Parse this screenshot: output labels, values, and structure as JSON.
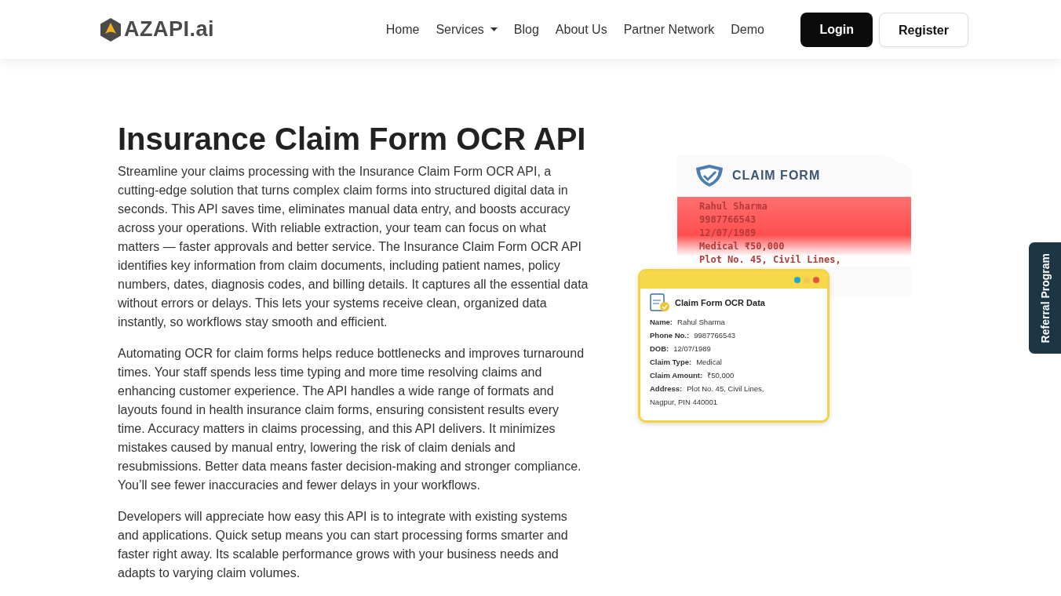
{
  "header": {
    "logo": "AZAPI.ai",
    "nav": [
      {
        "label": "Home",
        "dropdown": false
      },
      {
        "label": "Services",
        "dropdown": true
      },
      {
        "label": "Blog",
        "dropdown": false
      },
      {
        "label": "About Us",
        "dropdown": false
      },
      {
        "label": "Partner Network",
        "dropdown": false
      },
      {
        "label": "Demo",
        "dropdown": false
      }
    ],
    "buttons": [
      {
        "label": "Login",
        "kind": "primary"
      },
      {
        "label": "Register",
        "kind": "outline"
      }
    ]
  },
  "hero": {
    "title": "Insurance Claim Form OCR API",
    "paragraphs": [
      "Streamline your claims processing with the Insurance Claim Form OCR API, a cutting-edge solution that turns complex claim forms into structured digital data in seconds. This API saves time, eliminates manual data entry, and boosts accuracy across your operations. With reliable extraction, your team can focus on what matters — faster approvals and better service. The Insurance Claim Form OCR API identifies key information from claim documents, including patient names, policy numbers, dates, diagnosis codes, and billing details. It captures all the essential data without errors or delays. This lets your systems receive clean, organized data instantly, so workflows stay smooth and efficient.",
      "Automating OCR for claim forms helps reduce bottlenecks and improves turnaround times. Your staff spends less time typing and more time resolving claims and enhancing customer experience. The API handles a wide range of formats and layouts found in health insurance claim forms, ensuring consistent results every time. Accuracy matters in claims processing, and this API delivers. It minimizes mistakes caused by manual entry, lowering the risk of claim denials and resubmissions. Better data means faster decision-making and stronger compliance. You’ll see fewer inaccuracies and fewer delays in your workflows.",
      "Developers will appreciate how easy this API is to integrate with existing systems and applications. Quick setup means you can start processing forms smarter and faster right away. Its scalable performance grows with your business needs and adapts to varying claim volumes."
    ]
  },
  "illustration": {
    "form_title": "CLAIM FORM",
    "form_lines": [
      "Rahul Sharma",
      "9987766543",
      "12/07/1989",
      "Medical ₹50,000",
      "Plot No. 45, Civil Lines,"
    ],
    "card_title": "Claim Form OCR Data",
    "window_dots": [
      {
        "color": "#1ba8c9"
      },
      {
        "color": "#f2c94c"
      },
      {
        "color": "#e5533d"
      }
    ],
    "fields": [
      {
        "label": "Name:",
        "value": "Rahul Sharma"
      },
      {
        "label": "Phone No.:",
        "value": "9987766543"
      },
      {
        "label": "DOB:",
        "value": "12/07/1989"
      },
      {
        "label": "Claim Type:",
        "value": "Medical"
      },
      {
        "label": "Claim Amount:",
        "value": "₹50,000"
      },
      {
        "label": "Address:",
        "value": "Plot No. 45, Civil Lines,"
      }
    ],
    "address_line2": "Nagpur, PIN 440001"
  },
  "side_tab": "Referral Program"
}
